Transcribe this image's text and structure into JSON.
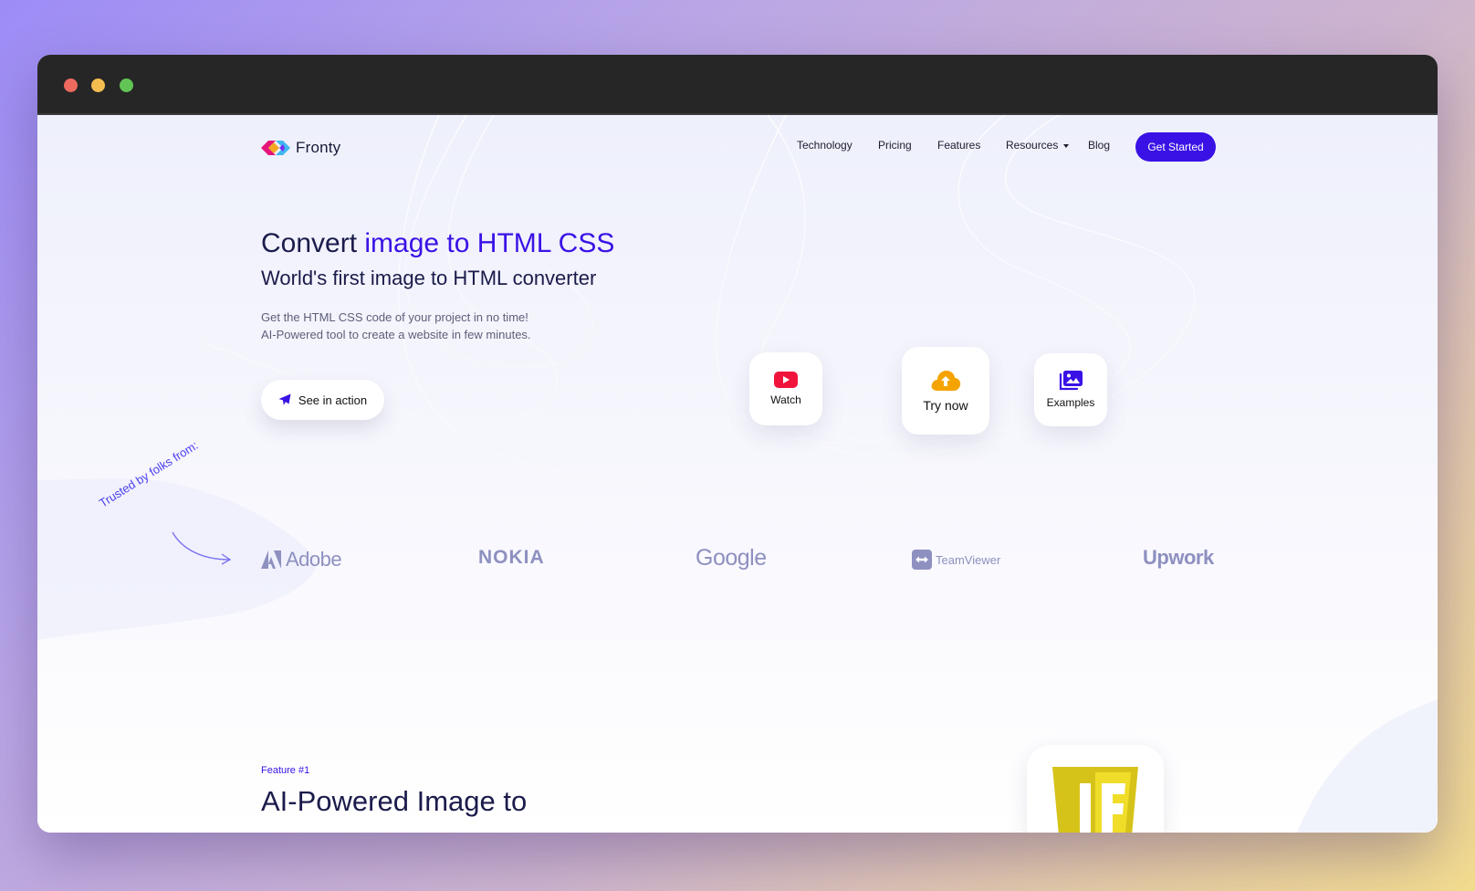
{
  "window": {
    "controls": [
      "close",
      "minimize",
      "maximize"
    ]
  },
  "brand": {
    "name": "Fronty",
    "logo_colors": [
      "#e6157b",
      "#f5a623",
      "#3fb7f0",
      "#7a2cf0"
    ]
  },
  "nav": {
    "links": [
      "Technology",
      "Pricing",
      "Features",
      "Resources",
      "Blog"
    ],
    "cta": "Get Started"
  },
  "hero": {
    "title_plain": "Convert",
    "title_accent": "image to HTML CSS",
    "subtitle": "World's first image to HTML converter",
    "desc_line1": "Get the HTML CSS code of your project in no time!",
    "desc_line2": "AI-Powered tool to create a website in few minutes.",
    "see_button": "See in action"
  },
  "cards": {
    "watch": "Watch",
    "try": "Try now",
    "examples": "Examples"
  },
  "trusted": {
    "label": "Trusted by folks from:",
    "companies": [
      "Adobe",
      "NOKIA",
      "Google",
      "TeamViewer",
      "Upwork"
    ]
  },
  "feature": {
    "tag": "Feature #1",
    "title": "AI-Powered Image to"
  },
  "colors": {
    "accent": "#3a12e6",
    "heading": "#1b1b4b",
    "muted": "#5d5f7a",
    "logo_gray": "#8e90c0",
    "youtube_red": "#f0143c",
    "upload_orange": "#f5a300"
  },
  "icons": {
    "watch": "youtube-play-icon",
    "try": "cloud-upload-icon",
    "examples": "image-gallery-icon",
    "see": "paper-plane-icon"
  }
}
